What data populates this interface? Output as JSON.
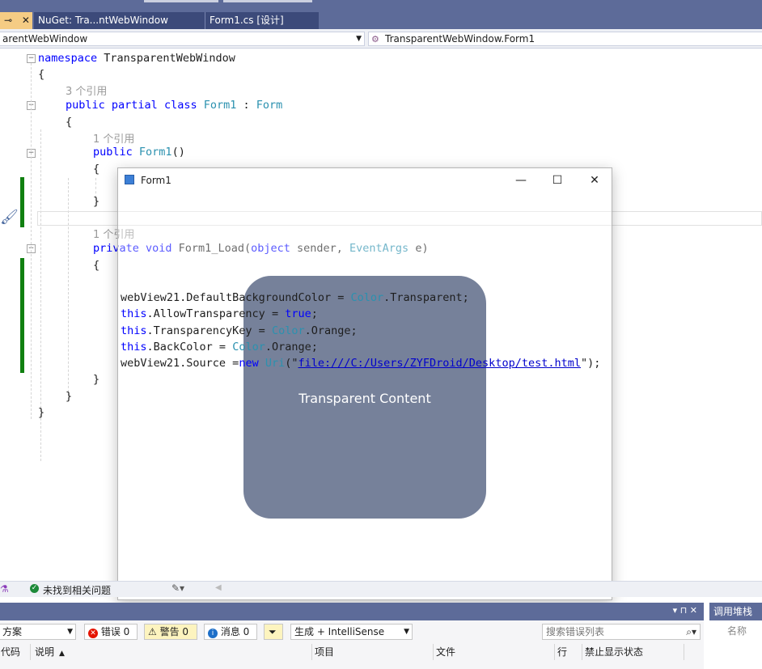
{
  "tabs": {
    "pinned_label": "⊸",
    "close_glyph": "✕",
    "nuget_label": "NuGet: Tra...ntWebWindow",
    "form_label": "Form1.cs [设计]"
  },
  "nav": {
    "left_combo": "arentWebWindow",
    "right_combo": "TransparentWebWindow.Form1"
  },
  "code": {
    "l1_kw": "namespace",
    "l1_name": " TransparentWebWindow",
    "brace_open": "{",
    "brace_close": "}",
    "ref3": "3 个引用",
    "ref1a": "1 个引用",
    "ref1b": "1 个引用",
    "l_public": "public",
    "l_partial": " partial",
    "l_class": " class",
    "l_form1": " Form1",
    "l_colon": " : ",
    "l_form": "Form",
    "ctor_public": "public",
    "ctor_name": " Form1",
    "ctor_paren": "()",
    "priv": "private",
    "void": " void",
    "load_name": " Form1_Load(",
    "object": "object",
    "sender": " sender, ",
    "eventargs": "EventArgs",
    "e": " e)",
    "s1a": "webView21.DefaultBackgroundColor = ",
    "s1b": "Color",
    "s1c": ".Transparent;",
    "s2a": "this",
    "s2b": ".AllowTransparency = ",
    "s2c": "true",
    "s2d": ";",
    "s3a": "this",
    "s3b": ".TransparencyKey = ",
    "s3c": "Color",
    "s3d": ".Orange;",
    "s4a": "this",
    "s4b": ".BackColor = ",
    "s4c": "Color",
    "s4d": ".Orange;",
    "s5a": "webView21.Source =",
    "s5b": "new",
    "s5c": " Uri",
    "s5d": "(\"",
    "s5e": "file:///C:/Users/ZYFDroid/Desktop/test.html",
    "s5f": "\");"
  },
  "form1": {
    "caption": "Form1",
    "minimize": "—",
    "maximize": "☐",
    "close": "✕",
    "content_text": "Transparent Content"
  },
  "status": {
    "issues_text": "未找到相关问题"
  },
  "panel": {
    "scope_combo": "方案",
    "errors_label": "错误 0",
    "warnings_label": "警告 0",
    "messages_label": "消息 0",
    "build_combo": "生成 + IntelliSense",
    "search_placeholder": "搜索错误列表",
    "col_code": "代码",
    "col_desc": "说明",
    "col_project": "项目",
    "col_file": "文件",
    "col_line": "行",
    "col_suppress": "禁止显示状态",
    "pin_glyphs": "▾ ⊓ ✕",
    "right_title": "调用堆栈",
    "right_col": "名称"
  },
  "colors": {
    "keyword": "#0000ff",
    "type": "#2b91af",
    "accent": "#5d6b99",
    "card": "#76819a"
  }
}
